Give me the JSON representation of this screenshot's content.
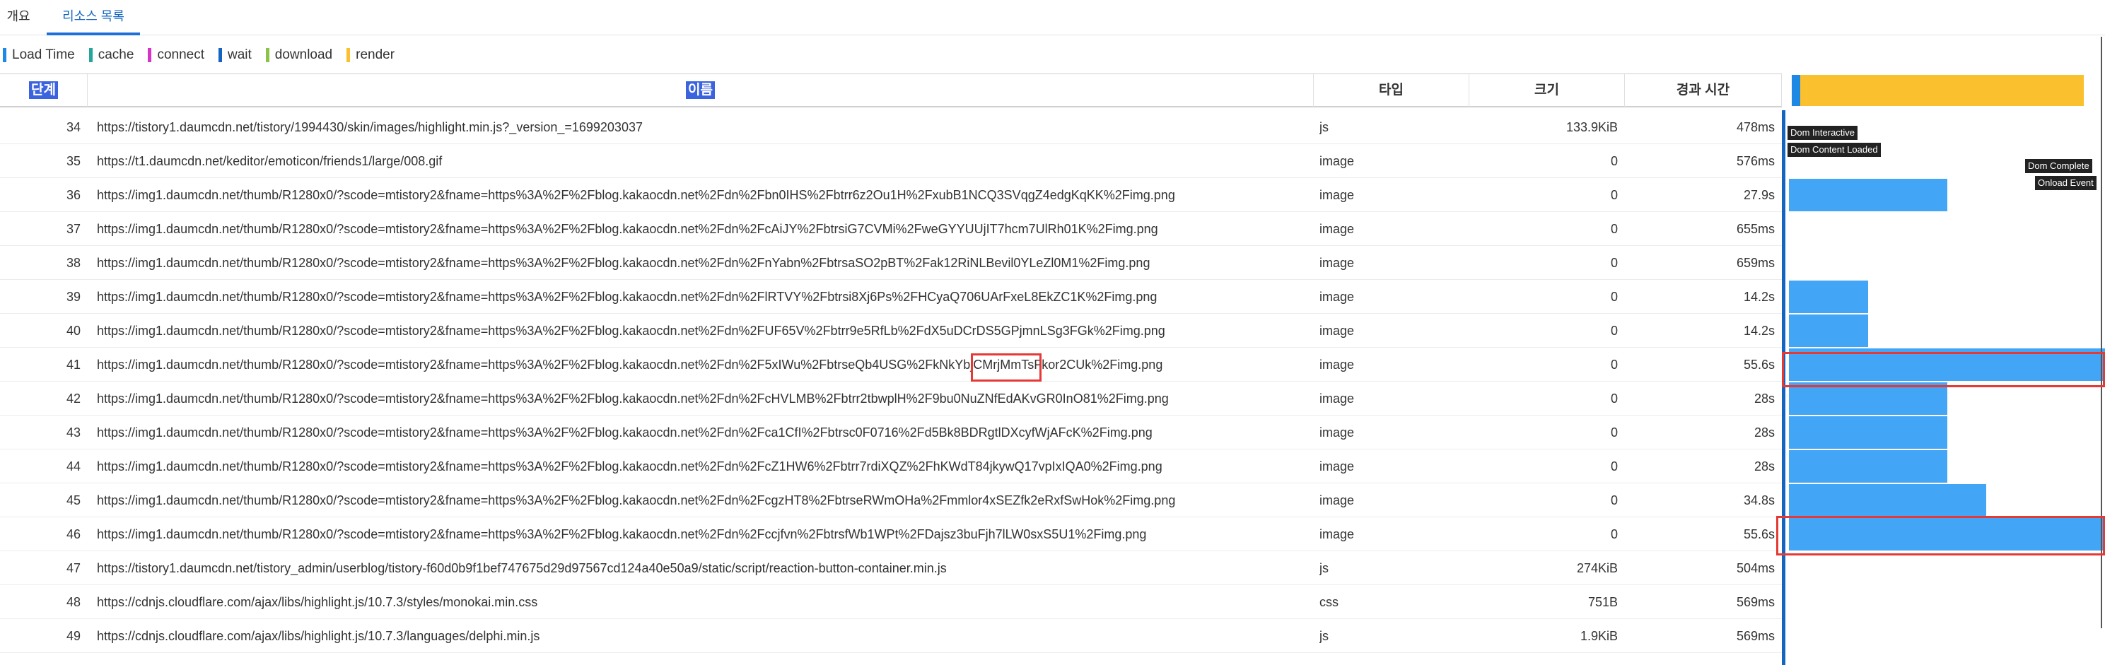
{
  "tabs": [
    {
      "label": "개요"
    },
    {
      "label": "리소스 목록",
      "active": true
    }
  ],
  "legend": [
    {
      "label": "Load Time",
      "color": "#1e88e5"
    },
    {
      "label": "cache",
      "color": "#26a69a"
    },
    {
      "label": "connect",
      "color": "#d633c9"
    },
    {
      "label": "wait",
      "color": "#1565c0"
    },
    {
      "label": "download",
      "color": "#8bc34a"
    },
    {
      "label": "render",
      "color": "#fbc02d"
    }
  ],
  "columns": {
    "step": "단계",
    "name": "이름",
    "type": "타입",
    "size": "크기",
    "elapsed": "경과 시간"
  },
  "rows": [
    {
      "step": "34",
      "name": "https://tistory1.daumcdn.net/tistory/1994430/skin/images/highlight.min.js?_version_=1699203037",
      "type": "js",
      "size": "133.9KiB",
      "time": "478ms",
      "bar": 0
    },
    {
      "step": "35",
      "name": "https://t1.daumcdn.net/keditor/emoticon/friends1/large/008.gif",
      "type": "image",
      "size": "0",
      "time": "576ms",
      "bar": 0
    },
    {
      "step": "36",
      "name": "https://img1.daumcdn.net/thumb/R1280x0/?scode=mtistory2&fname=https%3A%2F%2Fblog.kakaocdn.net%2Fdn%2Fbn0IHS%2Fbtrr6z2Ou1H%2FxubB1NCQ3SVqgZ4edgKqKK%2Fimg.png",
      "type": "image",
      "size": "0",
      "time": "27.9s",
      "bar": 0.5
    },
    {
      "step": "37",
      "name": "https://img1.daumcdn.net/thumb/R1280x0/?scode=mtistory2&fname=https%3A%2F%2Fblog.kakaocdn.net%2Fdn%2FcAiJY%2FbtrsiG7CVMi%2FweGYYUUjIT7hcm7UlRh01K%2Fimg.png",
      "type": "image",
      "size": "0",
      "time": "655ms",
      "bar": 0
    },
    {
      "step": "38",
      "name": "https://img1.daumcdn.net/thumb/R1280x0/?scode=mtistory2&fname=https%3A%2F%2Fblog.kakaocdn.net%2Fdn%2FnYabn%2FbtrsaSO2pBT%2Fak12RiNLBevil0YLeZl0M1%2Fimg.png",
      "type": "image",
      "size": "0",
      "time": "659ms",
      "bar": 0
    },
    {
      "step": "39",
      "name": "https://img1.daumcdn.net/thumb/R1280x0/?scode=mtistory2&fname=https%3A%2F%2Fblog.kakaocdn.net%2Fdn%2FlRTVY%2Fbtrsi8Xj6Ps%2FHCyaQ706UArFxeL8EkZC1K%2Fimg.png",
      "type": "image",
      "size": "0",
      "time": "14.2s",
      "bar": 0.25
    },
    {
      "step": "40",
      "name": "https://img1.daumcdn.net/thumb/R1280x0/?scode=mtistory2&fname=https%3A%2F%2Fblog.kakaocdn.net%2Fdn%2FUF65V%2Fbtrr9e5RfLb%2FdX5uDCrDS5GPjmnLSg3FGk%2Fimg.png",
      "type": "image",
      "size": "0",
      "time": "14.2s",
      "bar": 0.25
    },
    {
      "step": "41",
      "name": "https://img1.daumcdn.net/thumb/R1280x0/?scode=mtistory2&fname=https%3A%2F%2Fblog.kakaocdn.net%2Fdn%2F5xIWu%2FbtrseQb4USG%2FkNkYbjCMrjMmTsFkor2CUk%2Fimg.png",
      "type": "image",
      "size": "0",
      "time": "55.6s",
      "bar": 1
    },
    {
      "step": "42",
      "name": "https://img1.daumcdn.net/thumb/R1280x0/?scode=mtistory2&fname=https%3A%2F%2Fblog.kakaocdn.net%2Fdn%2FcHVLMB%2Fbtrr2tbwplH%2F9bu0NuZNfEdAKvGR0InO81%2Fimg.png",
      "type": "image",
      "size": "0",
      "time": "28s",
      "bar": 0.5
    },
    {
      "step": "43",
      "name": "https://img1.daumcdn.net/thumb/R1280x0/?scode=mtistory2&fname=https%3A%2F%2Fblog.kakaocdn.net%2Fdn%2Fca1CfI%2Fbtrsc0F0716%2Fd5Bk8BDRgtlDXcyfWjAFcK%2Fimg.png",
      "type": "image",
      "size": "0",
      "time": "28s",
      "bar": 0.5
    },
    {
      "step": "44",
      "name": "https://img1.daumcdn.net/thumb/R1280x0/?scode=mtistory2&fname=https%3A%2F%2Fblog.kakaocdn.net%2Fdn%2FcZ1HW6%2Fbtrr7rdiXQZ%2FhKWdT84jkywQ17vpIxIQA0%2Fimg.png",
      "type": "image",
      "size": "0",
      "time": "28s",
      "bar": 0.5
    },
    {
      "step": "45",
      "name": "https://img1.daumcdn.net/thumb/R1280x0/?scode=mtistory2&fname=https%3A%2F%2Fblog.kakaocdn.net%2Fdn%2FcgzHT8%2FbtrseRWmOHa%2Fmmlor4xSEZfk2eRxfSwHok%2Fimg.png",
      "type": "image",
      "size": "0",
      "time": "34.8s",
      "bar": 0.625
    },
    {
      "step": "46",
      "name": "https://img1.daumcdn.net/thumb/R1280x0/?scode=mtistory2&fname=https%3A%2F%2Fblog.kakaocdn.net%2Fdn%2Fccjfvn%2FbtrsfWb1WPt%2FDajsz3buFjh7lLW0sxS5U1%2Fimg.png",
      "type": "image",
      "size": "0",
      "time": "55.6s",
      "bar": 1
    },
    {
      "step": "47",
      "name": "https://tistory1.daumcdn.net/tistory_admin/userblog/tistory-f60d0b9f1bef747675d29d97567cd124a40e50a9/static/script/reaction-button-container.min.js",
      "type": "js",
      "size": "274KiB",
      "time": "504ms",
      "bar": 0
    },
    {
      "step": "48",
      "name": "https://cdnjs.cloudflare.com/ajax/libs/highlight.js/10.7.3/styles/monokai.min.css",
      "type": "css",
      "size": "751B",
      "time": "569ms",
      "bar": 0
    },
    {
      "step": "49",
      "name": "https://cdnjs.cloudflare.com/ajax/libs/highlight.js/10.7.3/languages/delphi.min.js",
      "type": "js",
      "size": "1.9KiB",
      "time": "569ms",
      "bar": 0
    }
  ],
  "waterfall": {
    "render_color": "#fbc02d",
    "bar_color": "#42a5f5",
    "markers": [
      {
        "label": "Dom Interactive"
      },
      {
        "label": "Dom Content Loaded"
      },
      {
        "label": "Dom Complete"
      },
      {
        "label": "Onload Event"
      }
    ]
  }
}
